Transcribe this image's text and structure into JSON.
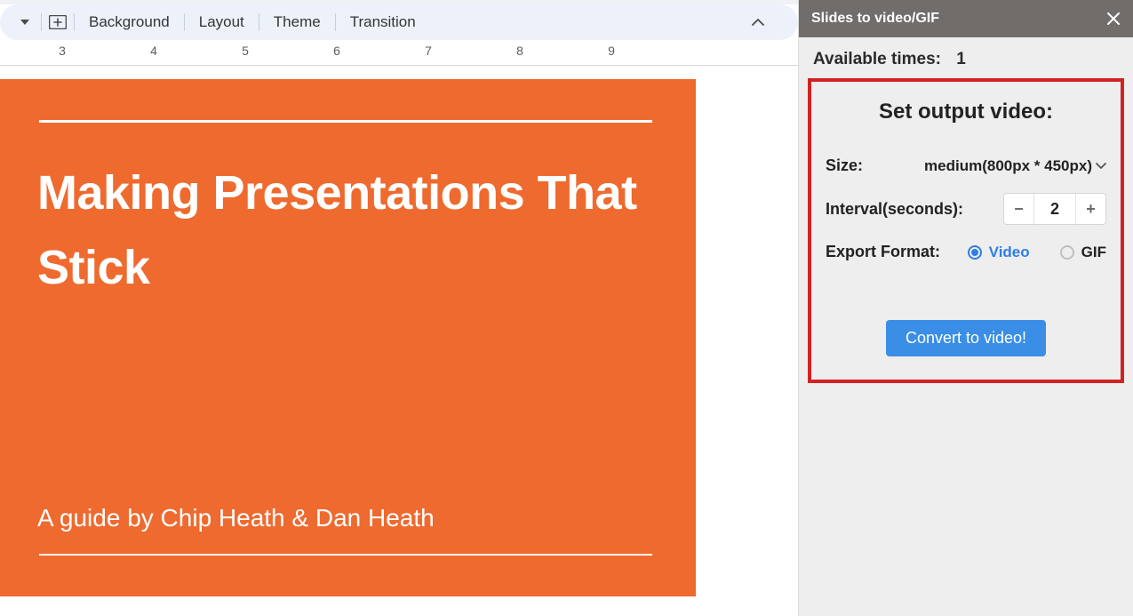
{
  "toolbar": {
    "background": "Background",
    "layout": "Layout",
    "theme": "Theme",
    "transition": "Transition"
  },
  "ruler": {
    "marks": [
      3,
      4,
      5,
      6,
      7,
      8,
      9
    ]
  },
  "slide": {
    "title": "Making Presentations That Stick",
    "subtitle": "A guide by Chip Heath & Dan Heath"
  },
  "panel": {
    "title": "Slides to video/GIF",
    "available_label": "Available times:",
    "available_value": "1",
    "heading": "Set output video:",
    "size_label": "Size:",
    "size_value": "medium(800px * 450px)",
    "interval_label": "Interval(seconds):",
    "interval_value": "2",
    "format_label": "Export Format:",
    "format_video": "Video",
    "format_gif": "GIF",
    "format_selected": "video",
    "convert_label": "Convert to video!"
  }
}
